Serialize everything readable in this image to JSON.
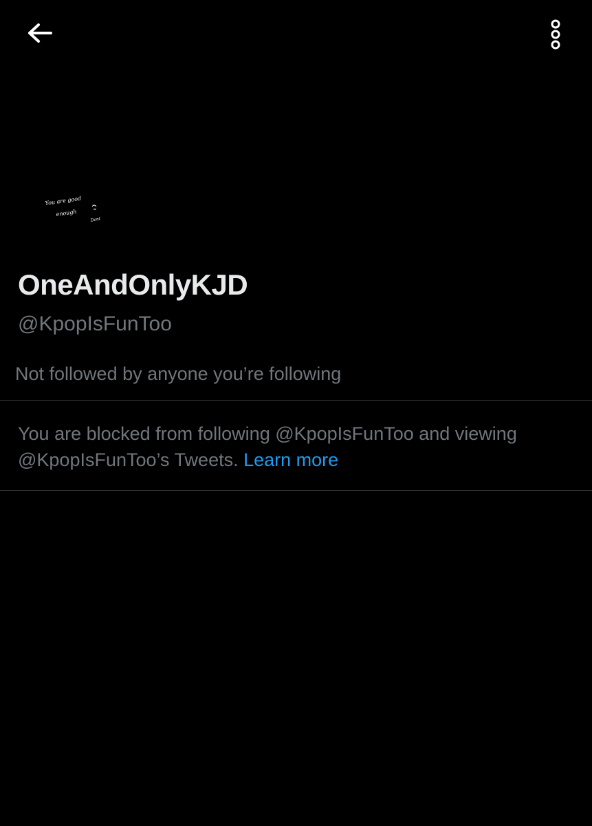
{
  "header": {
    "back_icon": "arrow-left-icon",
    "more_icon": "more-vertical-icon"
  },
  "profile": {
    "avatar_text_line1": "You are good",
    "avatar_text_line2": "enough",
    "avatar_text_line3": "Dont",
    "display_name": "OneAndOnlyKJD",
    "handle": "@KpopIsFunToo",
    "followed_by": "Not followed by anyone you’re following"
  },
  "blocked_notice": {
    "text": "You are blocked from following @KpopIsFunToo and viewing @KpopIsFunToo’s Tweets.",
    "link_label": "Learn more"
  },
  "colors": {
    "background": "#000000",
    "primary_text": "#e7e9ea",
    "secondary_text": "#71767b",
    "link": "#1d9bf0",
    "divider": "#2f3336"
  }
}
